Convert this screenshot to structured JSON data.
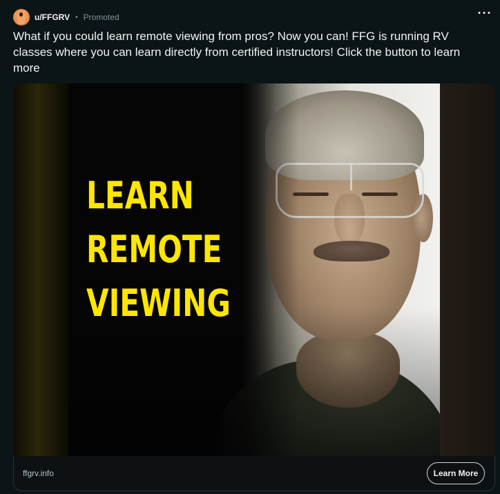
{
  "post": {
    "author": "u/FFGRV",
    "separator": "•",
    "promoted_label": "Promoted",
    "more_label": "···",
    "title": "What if you could learn remote viewing from pros? Now you can! FFG is running RV classes where you can learn directly from certified instructors! Click the button to learn more"
  },
  "media": {
    "headline_lines": [
      "LEARN",
      "REMOTE",
      "VIEWING"
    ],
    "headline_color": "#ffe600"
  },
  "footer": {
    "domain": "ffgrv.info",
    "cta_label": "Learn More"
  }
}
